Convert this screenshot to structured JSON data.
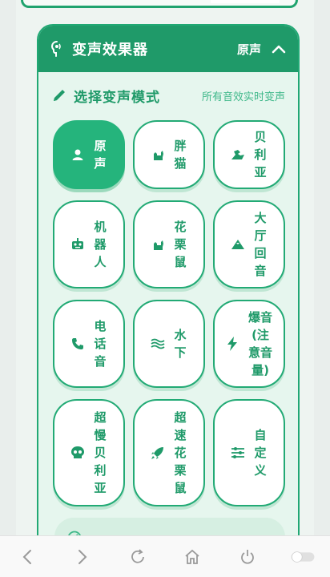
{
  "panel": {
    "title": "变声效果器",
    "current_mode": "原声"
  },
  "section": {
    "title": "选择变声模式",
    "note": "所有音效实时变声"
  },
  "modes": [
    {
      "label": "原声",
      "icon": "user-icon",
      "active": true
    },
    {
      "label": "胖猫",
      "icon": "cat-icon",
      "active": false
    },
    {
      "label": "贝利亚",
      "icon": "dragon-icon",
      "active": false
    },
    {
      "label": "机器人",
      "icon": "robot-icon",
      "active": false
    },
    {
      "label": "花栗鼠",
      "icon": "cat-icon",
      "active": false
    },
    {
      "label": "大厅回音",
      "icon": "mountain-icon",
      "active": false
    },
    {
      "label": "电话音",
      "icon": "phone-icon",
      "active": false
    },
    {
      "label": "水下",
      "icon": "water-icon",
      "active": false
    },
    {
      "label": "爆音(注意音量)",
      "icon": "bolt-icon",
      "active": false
    },
    {
      "label": "超慢贝利亚",
      "icon": "skull-icon",
      "active": false
    },
    {
      "label": "超速花栗鼠",
      "icon": "rocket-icon",
      "active": false
    },
    {
      "label": "自定义",
      "icon": "sliders-icon",
      "active": false
    }
  ],
  "toolbar": {
    "icons": [
      "back-icon",
      "forward-icon",
      "reload-icon",
      "home-icon",
      "power-icon",
      "toggle-switch"
    ]
  },
  "colors": {
    "accent": "#1f9a69",
    "active": "#25b47c",
    "panel_bg": "#e6f6ee"
  }
}
